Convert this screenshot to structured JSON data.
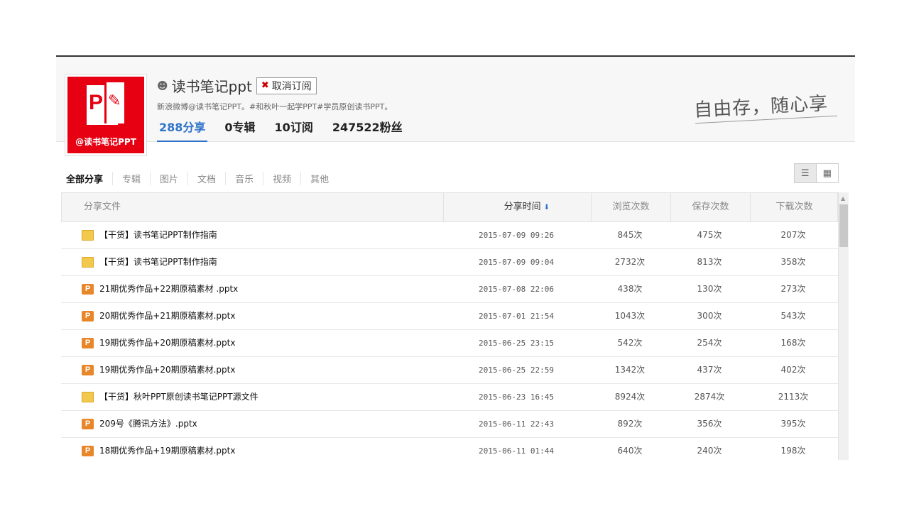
{
  "profile": {
    "avatar_caption": "@读书笔记PPT",
    "avatar_mark": "P",
    "username": "读书笔记ppt",
    "unsubscribe_label": "取消订阅",
    "description": "新浪微博@读书笔记PPT。#和秋叶一起学PPT#学员原创读书PPT。",
    "stats": [
      {
        "label": "288分享"
      },
      {
        "label": "0专辑"
      },
      {
        "label": "10订阅"
      },
      {
        "label": "247522粉丝"
      }
    ],
    "slogan": "自由存，随心享"
  },
  "tabs": [
    "全部分享",
    "专辑",
    "图片",
    "文档",
    "音乐",
    "视频",
    "其他"
  ],
  "table": {
    "headers": {
      "name": "分享文件",
      "time": "分享时间",
      "views": "浏览次数",
      "saves": "保存次数",
      "downloads": "下载次数"
    },
    "rows": [
      {
        "type": "folder",
        "name": "【干货】读书笔记PPT制作指南",
        "time": "2015-07-09 09:26",
        "views": "845次",
        "saves": "475次",
        "downloads": "207次"
      },
      {
        "type": "folder",
        "name": "【干货】读书笔记PPT制作指南",
        "time": "2015-07-09 09:04",
        "views": "2732次",
        "saves": "813次",
        "downloads": "358次"
      },
      {
        "type": "ppt",
        "name": "21期优秀作品+22期原稿素材 .pptx",
        "time": "2015-07-08 22:06",
        "views": "438次",
        "saves": "130次",
        "downloads": "273次"
      },
      {
        "type": "ppt",
        "name": "20期优秀作品+21期原稿素材.pptx",
        "time": "2015-07-01 21:54",
        "views": "1043次",
        "saves": "300次",
        "downloads": "543次"
      },
      {
        "type": "ppt",
        "name": "19期优秀作品+20期原稿素材.pptx",
        "time": "2015-06-25 23:15",
        "views": "542次",
        "saves": "254次",
        "downloads": "168次"
      },
      {
        "type": "ppt",
        "name": "19期优秀作品+20期原稿素材.pptx",
        "time": "2015-06-25 22:59",
        "views": "1342次",
        "saves": "437次",
        "downloads": "402次"
      },
      {
        "type": "folder",
        "name": "【干货】秋叶PPT原创读书笔记PPT源文件",
        "time": "2015-06-23 16:45",
        "views": "8924次",
        "saves": "2874次",
        "downloads": "2113次"
      },
      {
        "type": "ppt",
        "name": "209号《腾讯方法》.pptx",
        "time": "2015-06-11 22:43",
        "views": "892次",
        "saves": "356次",
        "downloads": "395次"
      },
      {
        "type": "ppt",
        "name": "18期优秀作品+19期原稿素材.pptx",
        "time": "2015-06-11 01:44",
        "views": "640次",
        "saves": "240次",
        "downloads": "198次"
      }
    ]
  },
  "colors": {
    "accent": "#2f73c8",
    "avatar_bg": "#e60012",
    "folder": "#f2c94c",
    "ppt": "#e8862a"
  }
}
